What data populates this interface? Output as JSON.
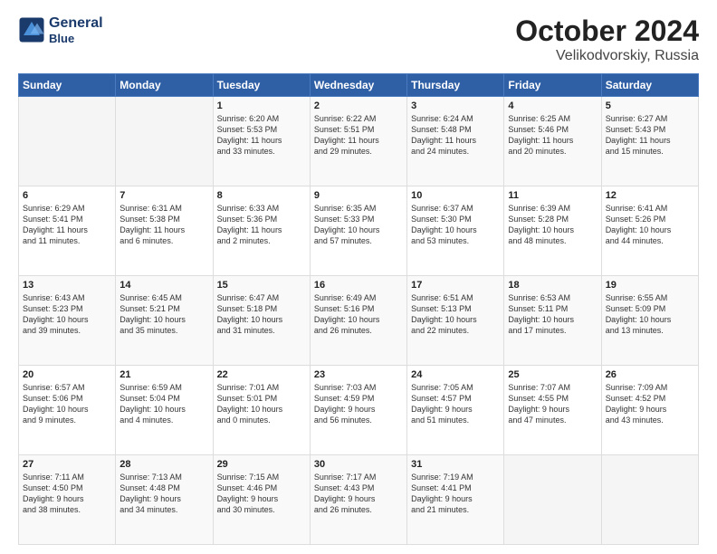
{
  "header": {
    "logo_line1": "General",
    "logo_line2": "Blue",
    "title": "October 2024",
    "subtitle": "Velikodvorskiy, Russia"
  },
  "weekdays": [
    "Sunday",
    "Monday",
    "Tuesday",
    "Wednesday",
    "Thursday",
    "Friday",
    "Saturday"
  ],
  "weeks": [
    [
      {
        "day": "",
        "info": ""
      },
      {
        "day": "",
        "info": ""
      },
      {
        "day": "1",
        "info": "Sunrise: 6:20 AM\nSunset: 5:53 PM\nDaylight: 11 hours\nand 33 minutes."
      },
      {
        "day": "2",
        "info": "Sunrise: 6:22 AM\nSunset: 5:51 PM\nDaylight: 11 hours\nand 29 minutes."
      },
      {
        "day": "3",
        "info": "Sunrise: 6:24 AM\nSunset: 5:48 PM\nDaylight: 11 hours\nand 24 minutes."
      },
      {
        "day": "4",
        "info": "Sunrise: 6:25 AM\nSunset: 5:46 PM\nDaylight: 11 hours\nand 20 minutes."
      },
      {
        "day": "5",
        "info": "Sunrise: 6:27 AM\nSunset: 5:43 PM\nDaylight: 11 hours\nand 15 minutes."
      }
    ],
    [
      {
        "day": "6",
        "info": "Sunrise: 6:29 AM\nSunset: 5:41 PM\nDaylight: 11 hours\nand 11 minutes."
      },
      {
        "day": "7",
        "info": "Sunrise: 6:31 AM\nSunset: 5:38 PM\nDaylight: 11 hours\nand 6 minutes."
      },
      {
        "day": "8",
        "info": "Sunrise: 6:33 AM\nSunset: 5:36 PM\nDaylight: 11 hours\nand 2 minutes."
      },
      {
        "day": "9",
        "info": "Sunrise: 6:35 AM\nSunset: 5:33 PM\nDaylight: 10 hours\nand 57 minutes."
      },
      {
        "day": "10",
        "info": "Sunrise: 6:37 AM\nSunset: 5:30 PM\nDaylight: 10 hours\nand 53 minutes."
      },
      {
        "day": "11",
        "info": "Sunrise: 6:39 AM\nSunset: 5:28 PM\nDaylight: 10 hours\nand 48 minutes."
      },
      {
        "day": "12",
        "info": "Sunrise: 6:41 AM\nSunset: 5:26 PM\nDaylight: 10 hours\nand 44 minutes."
      }
    ],
    [
      {
        "day": "13",
        "info": "Sunrise: 6:43 AM\nSunset: 5:23 PM\nDaylight: 10 hours\nand 39 minutes."
      },
      {
        "day": "14",
        "info": "Sunrise: 6:45 AM\nSunset: 5:21 PM\nDaylight: 10 hours\nand 35 minutes."
      },
      {
        "day": "15",
        "info": "Sunrise: 6:47 AM\nSunset: 5:18 PM\nDaylight: 10 hours\nand 31 minutes."
      },
      {
        "day": "16",
        "info": "Sunrise: 6:49 AM\nSunset: 5:16 PM\nDaylight: 10 hours\nand 26 minutes."
      },
      {
        "day": "17",
        "info": "Sunrise: 6:51 AM\nSunset: 5:13 PM\nDaylight: 10 hours\nand 22 minutes."
      },
      {
        "day": "18",
        "info": "Sunrise: 6:53 AM\nSunset: 5:11 PM\nDaylight: 10 hours\nand 17 minutes."
      },
      {
        "day": "19",
        "info": "Sunrise: 6:55 AM\nSunset: 5:09 PM\nDaylight: 10 hours\nand 13 minutes."
      }
    ],
    [
      {
        "day": "20",
        "info": "Sunrise: 6:57 AM\nSunset: 5:06 PM\nDaylight: 10 hours\nand 9 minutes."
      },
      {
        "day": "21",
        "info": "Sunrise: 6:59 AM\nSunset: 5:04 PM\nDaylight: 10 hours\nand 4 minutes."
      },
      {
        "day": "22",
        "info": "Sunrise: 7:01 AM\nSunset: 5:01 PM\nDaylight: 10 hours\nand 0 minutes."
      },
      {
        "day": "23",
        "info": "Sunrise: 7:03 AM\nSunset: 4:59 PM\nDaylight: 9 hours\nand 56 minutes."
      },
      {
        "day": "24",
        "info": "Sunrise: 7:05 AM\nSunset: 4:57 PM\nDaylight: 9 hours\nand 51 minutes."
      },
      {
        "day": "25",
        "info": "Sunrise: 7:07 AM\nSunset: 4:55 PM\nDaylight: 9 hours\nand 47 minutes."
      },
      {
        "day": "26",
        "info": "Sunrise: 7:09 AM\nSunset: 4:52 PM\nDaylight: 9 hours\nand 43 minutes."
      }
    ],
    [
      {
        "day": "27",
        "info": "Sunrise: 7:11 AM\nSunset: 4:50 PM\nDaylight: 9 hours\nand 38 minutes."
      },
      {
        "day": "28",
        "info": "Sunrise: 7:13 AM\nSunset: 4:48 PM\nDaylight: 9 hours\nand 34 minutes."
      },
      {
        "day": "29",
        "info": "Sunrise: 7:15 AM\nSunset: 4:46 PM\nDaylight: 9 hours\nand 30 minutes."
      },
      {
        "day": "30",
        "info": "Sunrise: 7:17 AM\nSunset: 4:43 PM\nDaylight: 9 hours\nand 26 minutes."
      },
      {
        "day": "31",
        "info": "Sunrise: 7:19 AM\nSunset: 4:41 PM\nDaylight: 9 hours\nand 21 minutes."
      },
      {
        "day": "",
        "info": ""
      },
      {
        "day": "",
        "info": ""
      }
    ]
  ]
}
